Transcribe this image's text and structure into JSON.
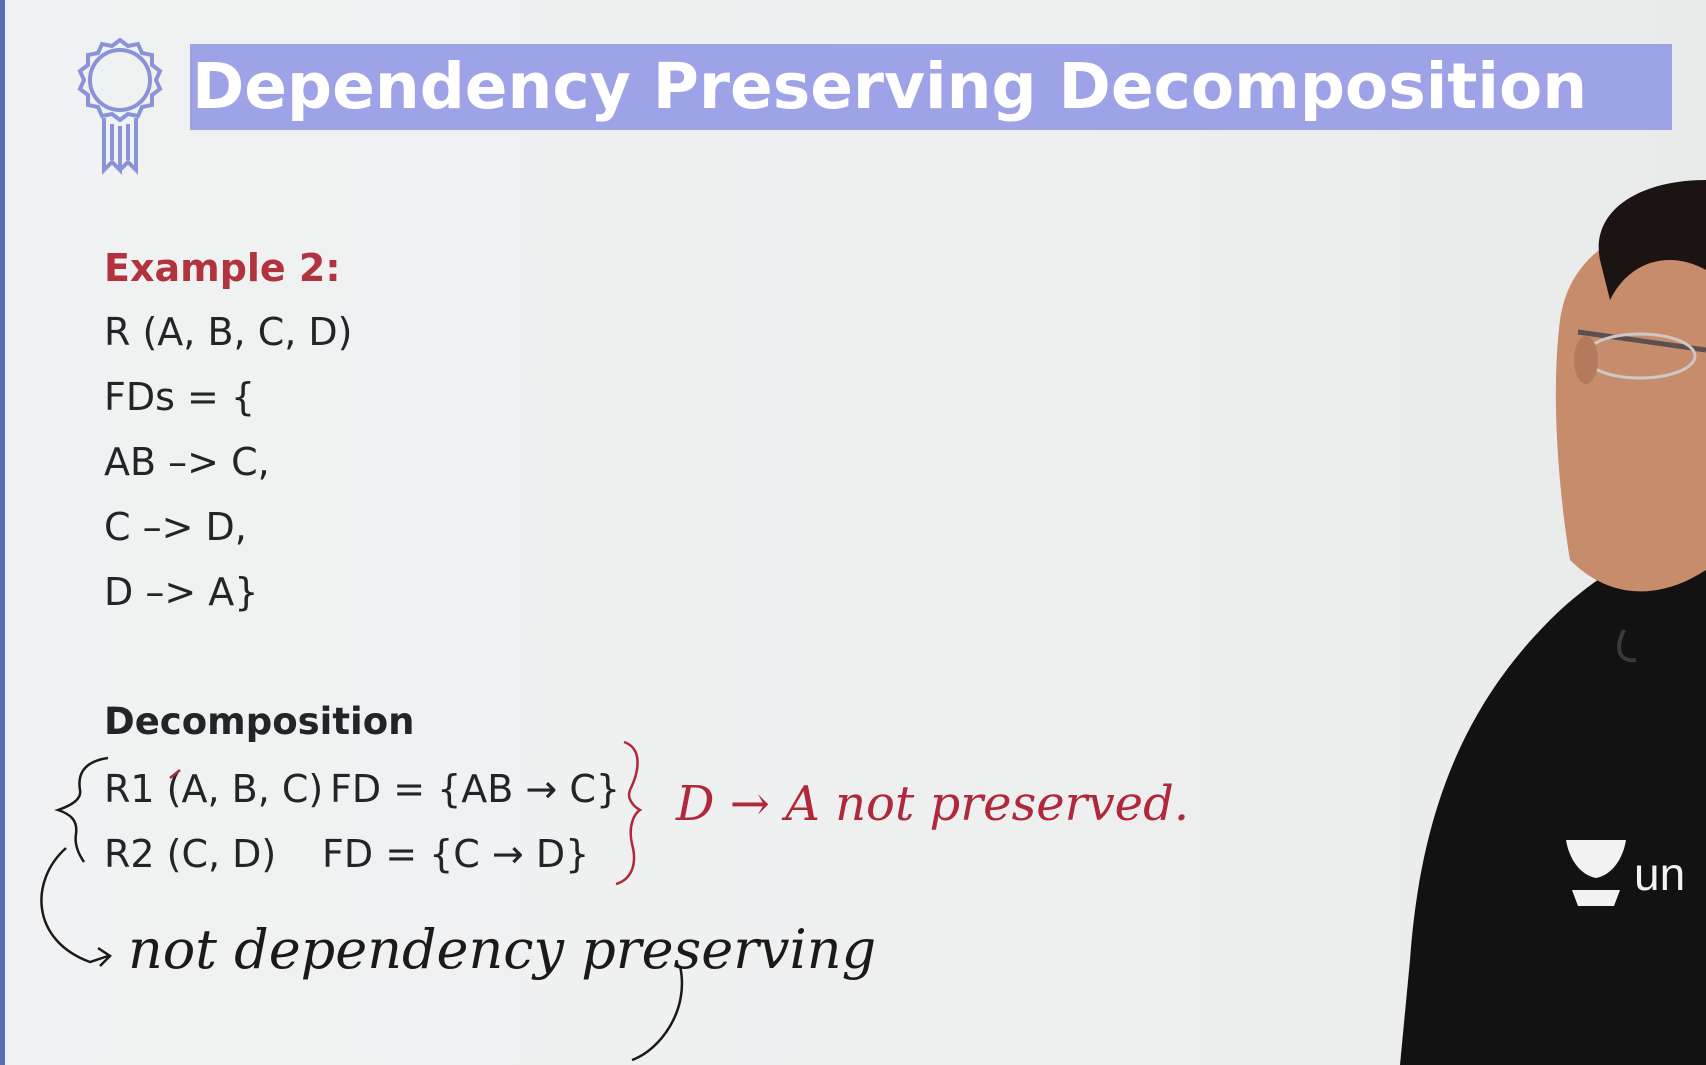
{
  "slide": {
    "title": "Dependency Preserving Decomposition",
    "example_label": "Example 2:",
    "relation": "R (A, B, C, D)",
    "fds_open": "FDs = {",
    "fd_lines": [
      "AB –> C,",
      "C –> D,",
      "D –> A}"
    ],
    "decomposition_label": "Decomposition",
    "decompositions": [
      {
        "relation": "R1 (A, B, C)",
        "fd": "FD = {AB → C}"
      },
      {
        "relation": "R2 (C, D)",
        "fd": "FD = {C → D}"
      }
    ]
  },
  "handwriting": {
    "note_right": "D → A not preserved.",
    "note_bottom": "not dependency preserving",
    "ink_colors": {
      "red": "#b0283a",
      "black": "#1a1a1a"
    }
  },
  "watermark": {
    "logo_text": "un"
  },
  "colors": {
    "title_band": "#9da3e6",
    "example_label": "#b0333d",
    "text": "#222428",
    "board": "#eef0f0"
  }
}
